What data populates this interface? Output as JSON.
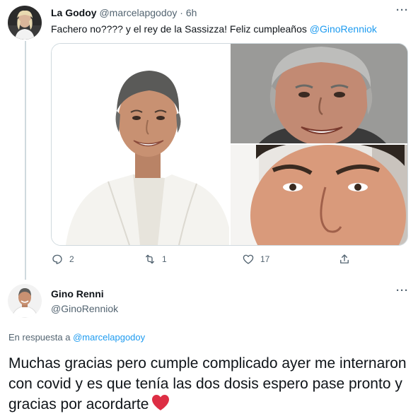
{
  "tweet": {
    "author_name": "La Godoy",
    "author_handle": "@marcelapgodoy",
    "separator": "·",
    "time": "6h",
    "text_main": "Fachero no???? y el rey de la Sassizza! Feliz cumpleaños ",
    "text_mention": "@GinoRenniok",
    "more_label": "···",
    "actions": {
      "reply_count": "2",
      "retweet_count": "1",
      "like_count": "17"
    }
  },
  "reply": {
    "author_name": "Gino Renni",
    "author_handle": "@GinoRenniok",
    "more_label": "···",
    "reply_prefix": "En respuesta a ",
    "reply_mention": "@marcelapgodoy",
    "text": "Muchas gracias pero cumple complicado ayer me internaron con covid y es que tenía las dos dosis espero pase pronto y gracias por acordarte"
  },
  "icons": {
    "reply": "reply-icon",
    "retweet": "retweet-icon",
    "like": "heart-icon",
    "share": "share-icon",
    "emoji": "red-heart-emoji"
  },
  "colors": {
    "accent": "#1d9bf0",
    "secondary_text": "#536471",
    "heart": "#dd2e44"
  }
}
